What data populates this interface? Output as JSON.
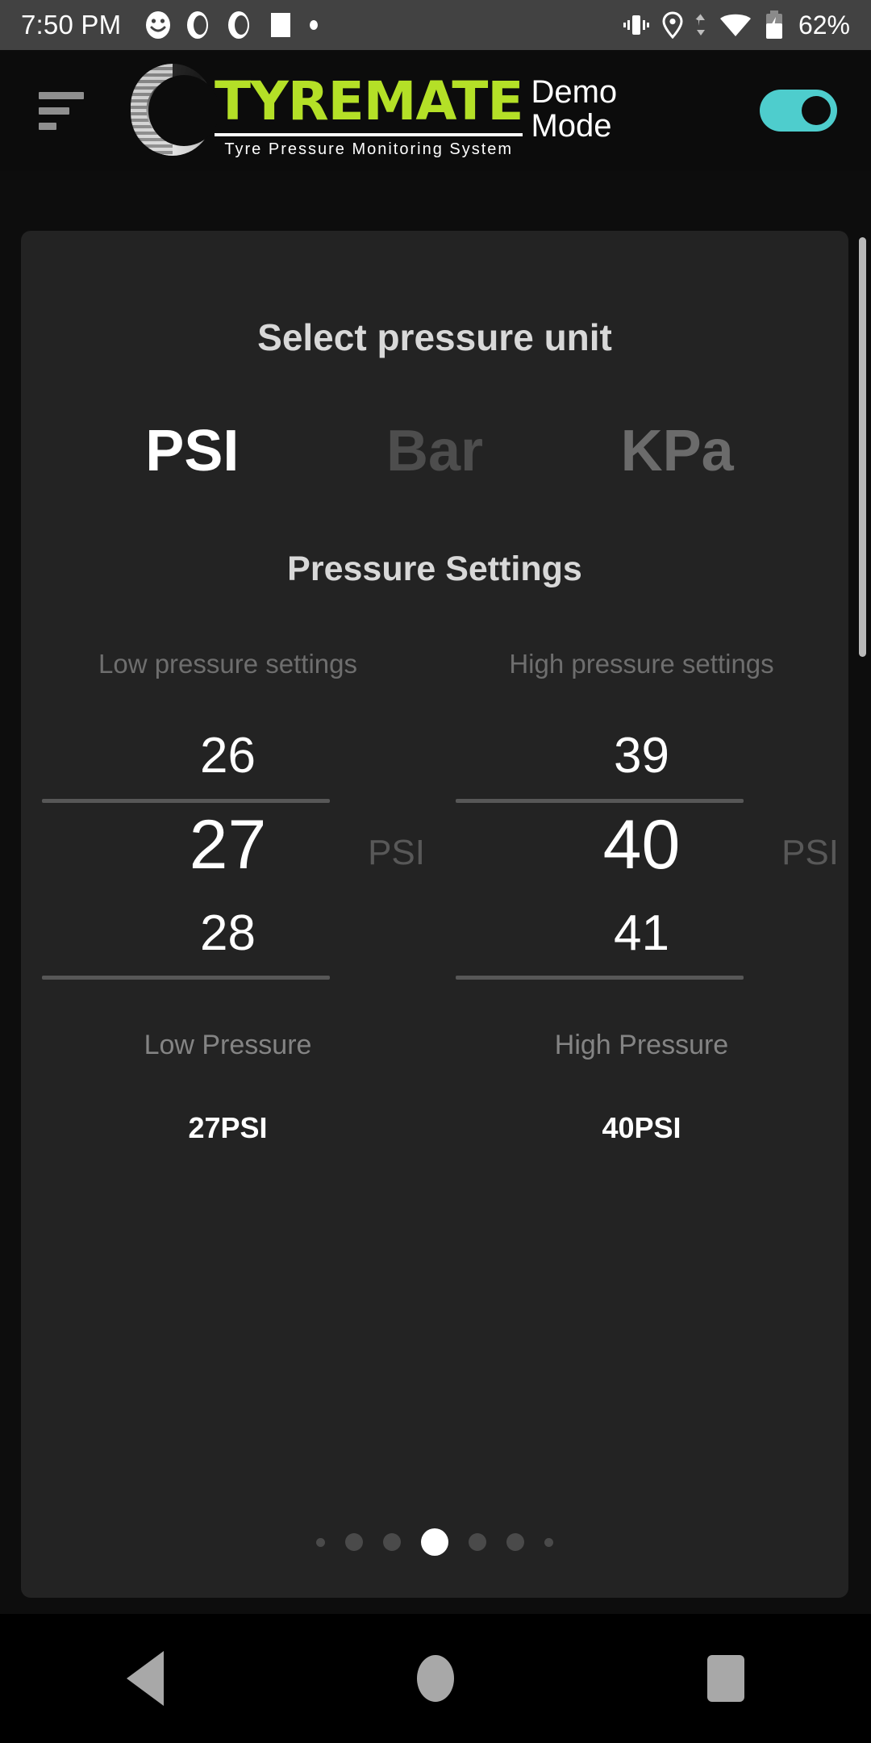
{
  "status_bar": {
    "time": "7:50 PM",
    "left_icons": [
      "smiley-face-icon",
      "tyre-sensor-icon",
      "tyre-sensor-icon",
      "square-app-icon",
      "dot-icon"
    ],
    "right_icons": [
      "vibrate-icon",
      "location-icon",
      "data-transfer-icon",
      "wifi-icon",
      "battery-charging-icon"
    ],
    "battery_percent": "62%"
  },
  "app_bar": {
    "menu_icon": "hamburger-menu-icon",
    "logo_name": "TYREMATE",
    "logo_subtitle": "Tyre Pressure Monitoring System",
    "demo_mode_label": "Demo Mode",
    "demo_mode_on": true,
    "accent_green": "#b4e027",
    "toggle_color": "#4ecdcd"
  },
  "card": {
    "unit_selector_title": "Select pressure unit",
    "units": [
      {
        "label": "PSI",
        "selected": true
      },
      {
        "label": "Bar",
        "selected": false
      },
      {
        "label": "KPa",
        "selected": false
      }
    ],
    "pressure_settings_title": "Pressure Settings",
    "low": {
      "column_label": "Low pressure settings",
      "prev_value": "26",
      "selected_value": "27",
      "next_value": "28",
      "unit": "PSI",
      "summary_label": "Low Pressure",
      "summary_value": "27PSI"
    },
    "high": {
      "column_label": "High pressure settings",
      "prev_value": "39",
      "selected_value": "40",
      "next_value": "41",
      "unit": "PSI",
      "summary_label": "High Pressure",
      "summary_value": "40PSI"
    },
    "page_dots": {
      "count": 7,
      "active_index": 3
    }
  },
  "nav_bar": {
    "back": "back-triangle-icon",
    "home": "home-circle-icon",
    "recents": "recents-square-icon"
  }
}
